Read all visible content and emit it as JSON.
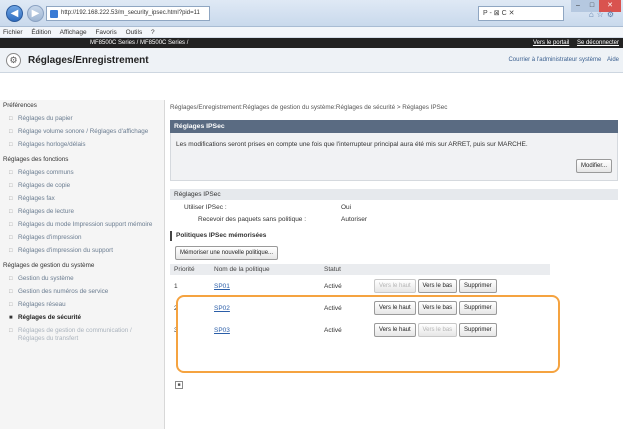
{
  "browser": {
    "url": "http://192.168.222.53/m_security_ipsec.html?pid=11",
    "search_placeholder": "P - ⊠ C ✕",
    "menu": [
      "Fichier",
      "Édition",
      "Affichage",
      "Favoris",
      "Outils",
      "?"
    ]
  },
  "header": {
    "model": "MF8500C Series / MF8500C Series /",
    "portal_link": "Vers le portail",
    "logout_link": "Se déconnecter",
    "title": "Réglages/Enregistrement",
    "mail_admin": "Courrier à l'administrateur système",
    "help": "Aide"
  },
  "sidebar": {
    "sections": [
      {
        "title": "Préférences",
        "items": [
          "Réglages du papier",
          "Réglage volume sonore / Réglages d'affichage",
          "Réglages horloge/délais"
        ]
      },
      {
        "title": "Réglages des fonctions",
        "items": [
          "Réglages communs",
          "Réglages de copie",
          "Réglages fax",
          "Réglages de lecture",
          "Réglages du mode Impression support mémoire",
          "Réglages d'impression",
          "Réglages d'impression du support"
        ]
      },
      {
        "title": "Réglages de gestion du système",
        "items": [
          "Gestion du système",
          "Gestion des numéros de service",
          "Réglages réseau",
          "Réglages de sécurité",
          "Réglages de gestion de communication / Réglages du transfert"
        ]
      }
    ],
    "active_item": "Réglages de sécurité"
  },
  "main": {
    "breadcrumb": "Réglages/Enregistrement:Réglages de gestion du système:Réglages de sécurité > Réglages IPSec",
    "panel_title": "Réglages IPSec",
    "panel_note": "Les modifications seront prises en compte une fois que l'interrupteur principal aura été mis sur ARRET, puis sur MARCHE.",
    "modify_button": "Modifier...",
    "settings_head": "Réglages IPSec",
    "use_ipsec_label": "Utiliser IPSec :",
    "use_ipsec_value": "Oui",
    "receive_label": "Recevoir des paquets sans politique :",
    "receive_value": "Autoriser",
    "policies_head": "Politiques IPSec mémorisées",
    "register_button": "Mémoriser une nouvelle politique...",
    "table_headers": [
      "Priorité",
      "Nom de la politique",
      "Statut"
    ],
    "policies": [
      {
        "priority": "1",
        "name": "SP01",
        "status": "Activé",
        "up": "Vers le haut",
        "down": "Vers le bas",
        "delete": "Supprimer"
      },
      {
        "priority": "2",
        "name": "SP02",
        "status": "Activé",
        "up": "Vers le haut",
        "down": "Vers le bas",
        "delete": "Supprimer"
      },
      {
        "priority": "3",
        "name": "SP03",
        "status": "Activé",
        "up": "Vers le haut",
        "down": "Vers le bas",
        "delete": "Supprimer"
      }
    ]
  }
}
